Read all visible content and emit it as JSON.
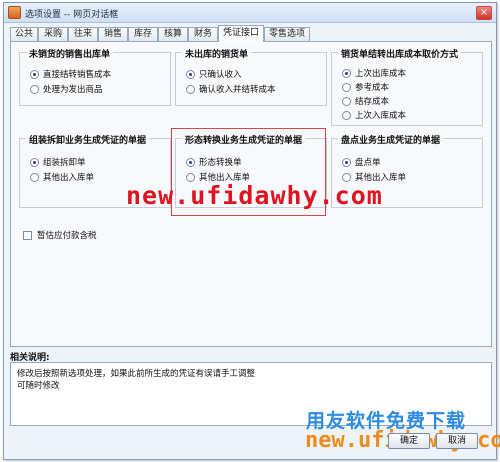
{
  "window": {
    "title": "选项设置 -- 网页对话框",
    "close_glyph": "×"
  },
  "tabs": [
    "公共",
    "采购",
    "往来",
    "销售",
    "库存",
    "核算",
    "财务",
    "凭证接口",
    "零售选项"
  ],
  "active_tab": "凭证接口",
  "groups": {
    "unsold_sales_outbound": {
      "title": "未销货的销售出库单",
      "options": [
        {
          "label": "直接结转销售成本",
          "selected": true
        },
        {
          "label": "处理为发出商品",
          "selected": false
        }
      ]
    },
    "unshipped_sales": {
      "title": "未出库的销货单",
      "options": [
        {
          "label": "只确认收入",
          "selected": true
        },
        {
          "label": "确认收入并结转成本",
          "selected": false
        }
      ]
    },
    "cost_source": {
      "title": "销货单结转出库成本取价方式",
      "options": [
        {
          "label": "上次出库成本",
          "selected": true
        },
        {
          "label": "参考成本",
          "selected": false
        },
        {
          "label": "结存成本",
          "selected": false
        },
        {
          "label": "上次入库成本",
          "selected": false
        }
      ]
    },
    "assembly": {
      "title": "组装拆卸业务生成凭证的单据",
      "options": [
        {
          "label": "组装拆卸单",
          "selected": true
        },
        {
          "label": "其他出入库单",
          "selected": false
        }
      ]
    },
    "conversion": {
      "title": "形态转换业务生成凭证的单据",
      "options": [
        {
          "label": "形态转换单",
          "selected": true
        },
        {
          "label": "其他出入库单",
          "selected": false
        }
      ]
    },
    "stocktake": {
      "title": "盘点业务生成凭证的单据",
      "options": [
        {
          "label": "盘点单",
          "selected": true
        },
        {
          "label": "其他出入库单",
          "selected": false
        }
      ]
    }
  },
  "estimate_tax_checkbox": {
    "label": "暂估应付款含税",
    "checked": false
  },
  "description": {
    "title": "相关说明:",
    "lines": [
      "修改后按照新选项处理，如果此前所生成的凭证有误请手工调整",
      "可随时修改"
    ]
  },
  "watermarks": {
    "middle_url": "new.ufidawhy.com",
    "brand_text": "用友软件免费下载",
    "bottom_url": "new.ufidawhy.com"
  },
  "buttons": {
    "ok": "确定",
    "cancel": "取消"
  }
}
